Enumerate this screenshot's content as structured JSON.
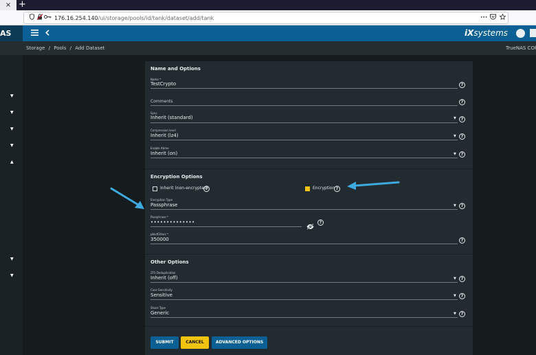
{
  "browser": {
    "tab_close": "×",
    "new_tab": "+",
    "url_host": "176.16.254.140",
    "url_path": "/ui/storage/pools/id/tank/dataset/add/tank",
    "icons": [
      "shield-icon",
      "lock-slash-icon",
      "key-icon",
      "more-icon",
      "pocket-icon",
      "star-icon"
    ],
    "more_label": "···"
  },
  "app": {
    "brand_left": "AS",
    "logo_prefix": "iX",
    "logo_suffix": "systems",
    "product": "TrueNAS CORE"
  },
  "breadcrumb": [
    "Storage",
    "/",
    "Pools",
    "/",
    "Add Dataset"
  ],
  "form": {
    "name_options": {
      "title": "Name and Options",
      "name_label": "Name *",
      "name_value": "TestCrypto",
      "comments_label": "Comments",
      "sync_label": "Sync",
      "sync_value": "Inherit (standard)",
      "compression_label": "Compression level",
      "compression_value": "Inherit (lz4)",
      "atime_label": "Enable Atime",
      "atime_value": "Inherit (on)"
    },
    "encryption": {
      "title": "Encryption Options",
      "inherit_label": "Inherit (non-encrypted)",
      "inherit_checked": false,
      "encryption_label": "Encryption",
      "encryption_checked": true,
      "type_label": "Encryption Type",
      "type_value": "Passphrase",
      "passphrase_label": "Passphrase *",
      "passphrase_value": "••••••••••••••",
      "pbkdf2_label": "pbkdf2iters *",
      "pbkdf2_value": "350000"
    },
    "other": {
      "title": "Other Options",
      "dedup_label": "ZFS Deduplication",
      "dedup_value": "Inherit (off)",
      "case_label": "Case Sensitivity",
      "case_value": "Sensitive",
      "share_label": "Share Type",
      "share_value": "Generic"
    },
    "buttons": {
      "submit": "SUBMIT",
      "cancel": "CANCEL",
      "advanced": "ADVANCED OPTIONS"
    },
    "help_glyph": "?"
  },
  "colors": {
    "accent_blue": "#0a5f95",
    "accent_yellow": "#f2c40d",
    "annotation_arrow": "#3ea9dc"
  }
}
